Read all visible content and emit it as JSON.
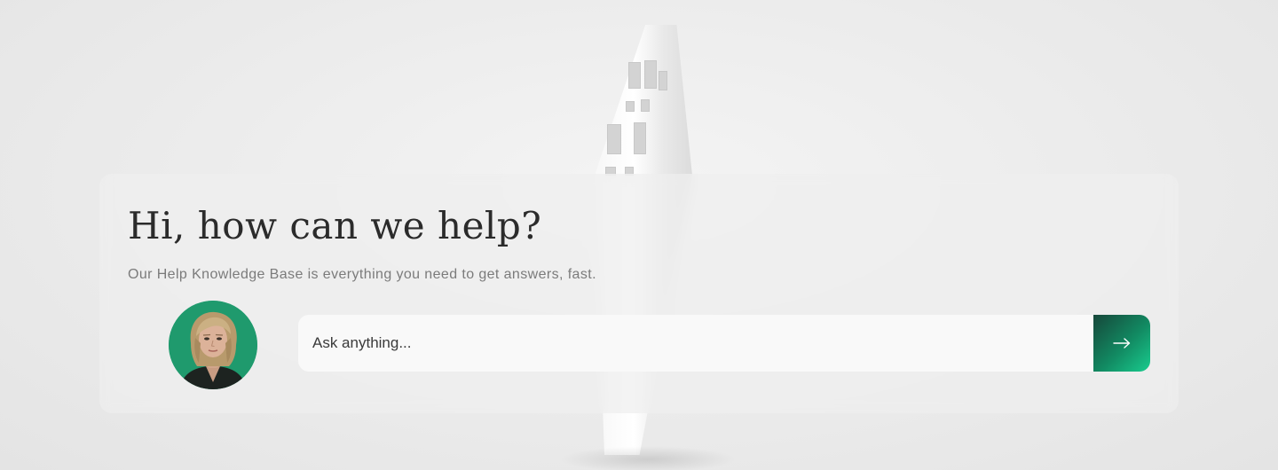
{
  "hero": {
    "title": "Hi, how can we help?",
    "subtitle": "Our Help Knowledge Base is everything you need to get answers, fast."
  },
  "search": {
    "placeholder": "Ask anything...",
    "value": "",
    "submit_icon": "arrow-right-icon",
    "submit_label": "Submit search"
  },
  "avatar": {
    "alt": "Support agent avatar",
    "ring_color": "#1f9a6d"
  },
  "colors": {
    "accent_dark": "#16473a",
    "accent_light": "#19cc8e",
    "title": "#2b2b2b",
    "subtitle": "#7b7b7b"
  }
}
